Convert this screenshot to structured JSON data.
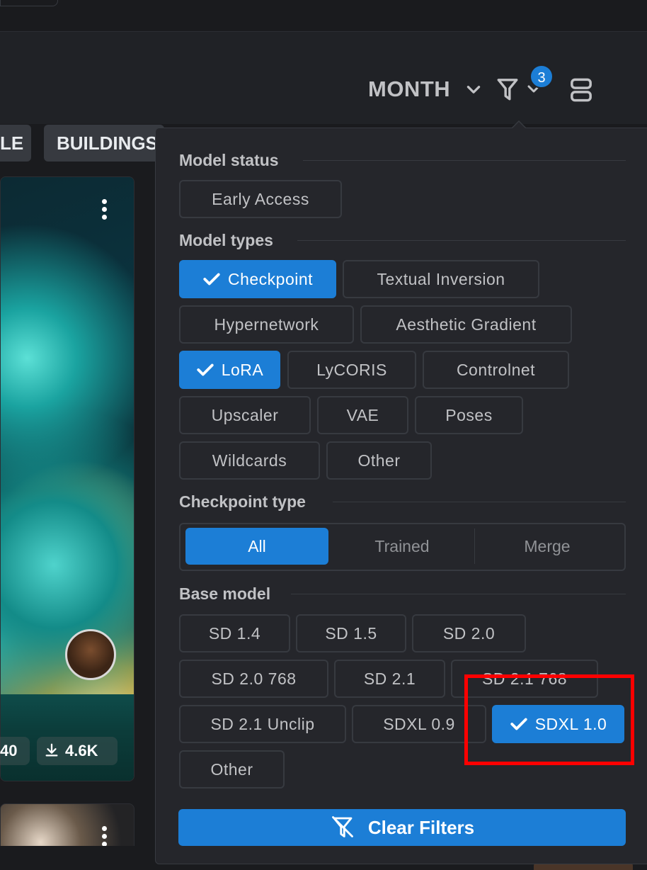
{
  "header": {
    "period_label": "MONTH",
    "filter_count": "3",
    "icons": [
      "chevron-down-icon",
      "filter-icon",
      "layout-icon"
    ]
  },
  "tags": [
    "LE",
    "BUILDINGS"
  ],
  "card": {
    "stats": [
      {
        "icon": null,
        "value": "40"
      },
      {
        "icon": "download-icon",
        "value": "4.6K"
      }
    ]
  },
  "filters": {
    "model_status": {
      "title": "Model status",
      "options": [
        {
          "label": "Early Access",
          "selected": false
        }
      ]
    },
    "model_types": {
      "title": "Model types",
      "options": [
        {
          "label": "Checkpoint",
          "selected": true
        },
        {
          "label": "Textual Inversion",
          "selected": false
        },
        {
          "label": "Hypernetwork",
          "selected": false
        },
        {
          "label": "Aesthetic Gradient",
          "selected": false
        },
        {
          "label": "LoRA",
          "selected": true
        },
        {
          "label": "LyCORIS",
          "selected": false
        },
        {
          "label": "Controlnet",
          "selected": false
        },
        {
          "label": "Upscaler",
          "selected": false
        },
        {
          "label": "VAE",
          "selected": false
        },
        {
          "label": "Poses",
          "selected": false
        },
        {
          "label": "Wildcards",
          "selected": false
        },
        {
          "label": "Other",
          "selected": false
        }
      ]
    },
    "checkpoint_type": {
      "title": "Checkpoint type",
      "options": [
        "All",
        "Trained",
        "Merge"
      ],
      "selected": "All"
    },
    "base_model": {
      "title": "Base model",
      "options": [
        {
          "label": "SD 1.4",
          "selected": false
        },
        {
          "label": "SD 1.5",
          "selected": false
        },
        {
          "label": "SD 2.0",
          "selected": false
        },
        {
          "label": "SD 2.0 768",
          "selected": false
        },
        {
          "label": "SD 2.1",
          "selected": false
        },
        {
          "label": "SD 2.1 768",
          "selected": false
        },
        {
          "label": "SD 2.1 Unclip",
          "selected": false
        },
        {
          "label": "SDXL 0.9",
          "selected": false
        },
        {
          "label": "SDXL 1.0",
          "selected": true
        },
        {
          "label": "Other",
          "selected": false
        }
      ]
    },
    "clear_label": "Clear Filters"
  },
  "colors": {
    "accent": "#1c7ed6",
    "highlight": "#ff0000",
    "panel_bg": "#25262b",
    "page_bg": "#1a1b1e"
  }
}
